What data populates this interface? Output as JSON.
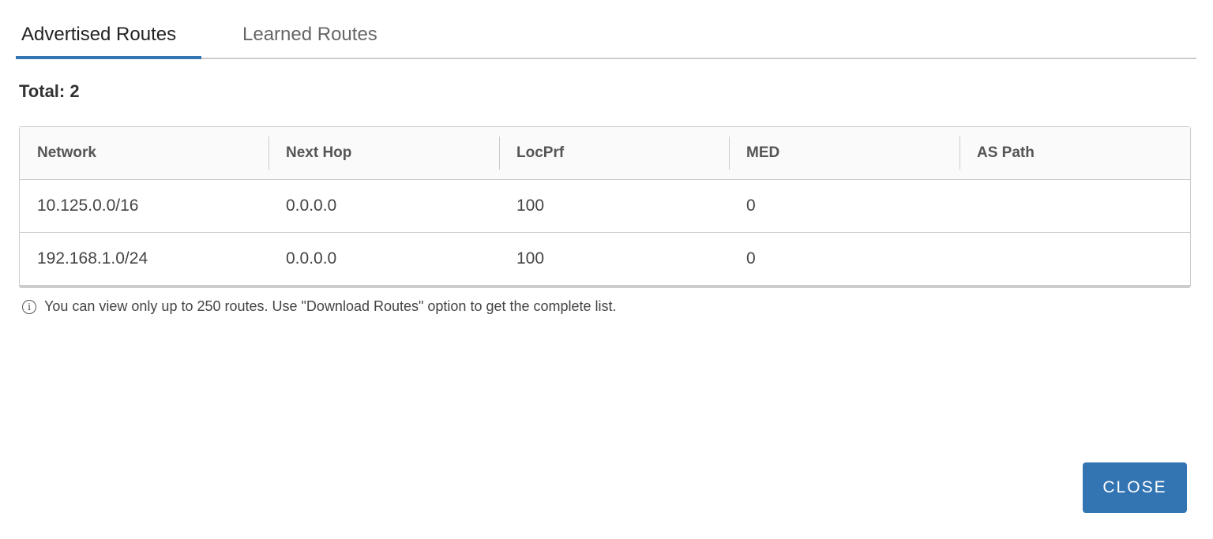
{
  "tabs": [
    {
      "label": "Advertised Routes",
      "active": true
    },
    {
      "label": "Learned Routes",
      "active": false
    }
  ],
  "total": "Total: 2",
  "table": {
    "columns": [
      "Network",
      "Next Hop",
      "LocPrf",
      "MED",
      "AS Path"
    ],
    "rows": [
      [
        "10.125.0.0/16",
        "0.0.0.0",
        "100",
        "0",
        ""
      ],
      [
        "192.168.1.0/24",
        "0.0.0.0",
        "100",
        "0",
        ""
      ]
    ]
  },
  "info": {
    "icon": "info-icon",
    "text": "You can view only up to 250 routes. Use \"Download Routes\" option to get the complete list."
  },
  "close_label": "CLOSE",
  "colors": {
    "accent": "#3374b3"
  }
}
